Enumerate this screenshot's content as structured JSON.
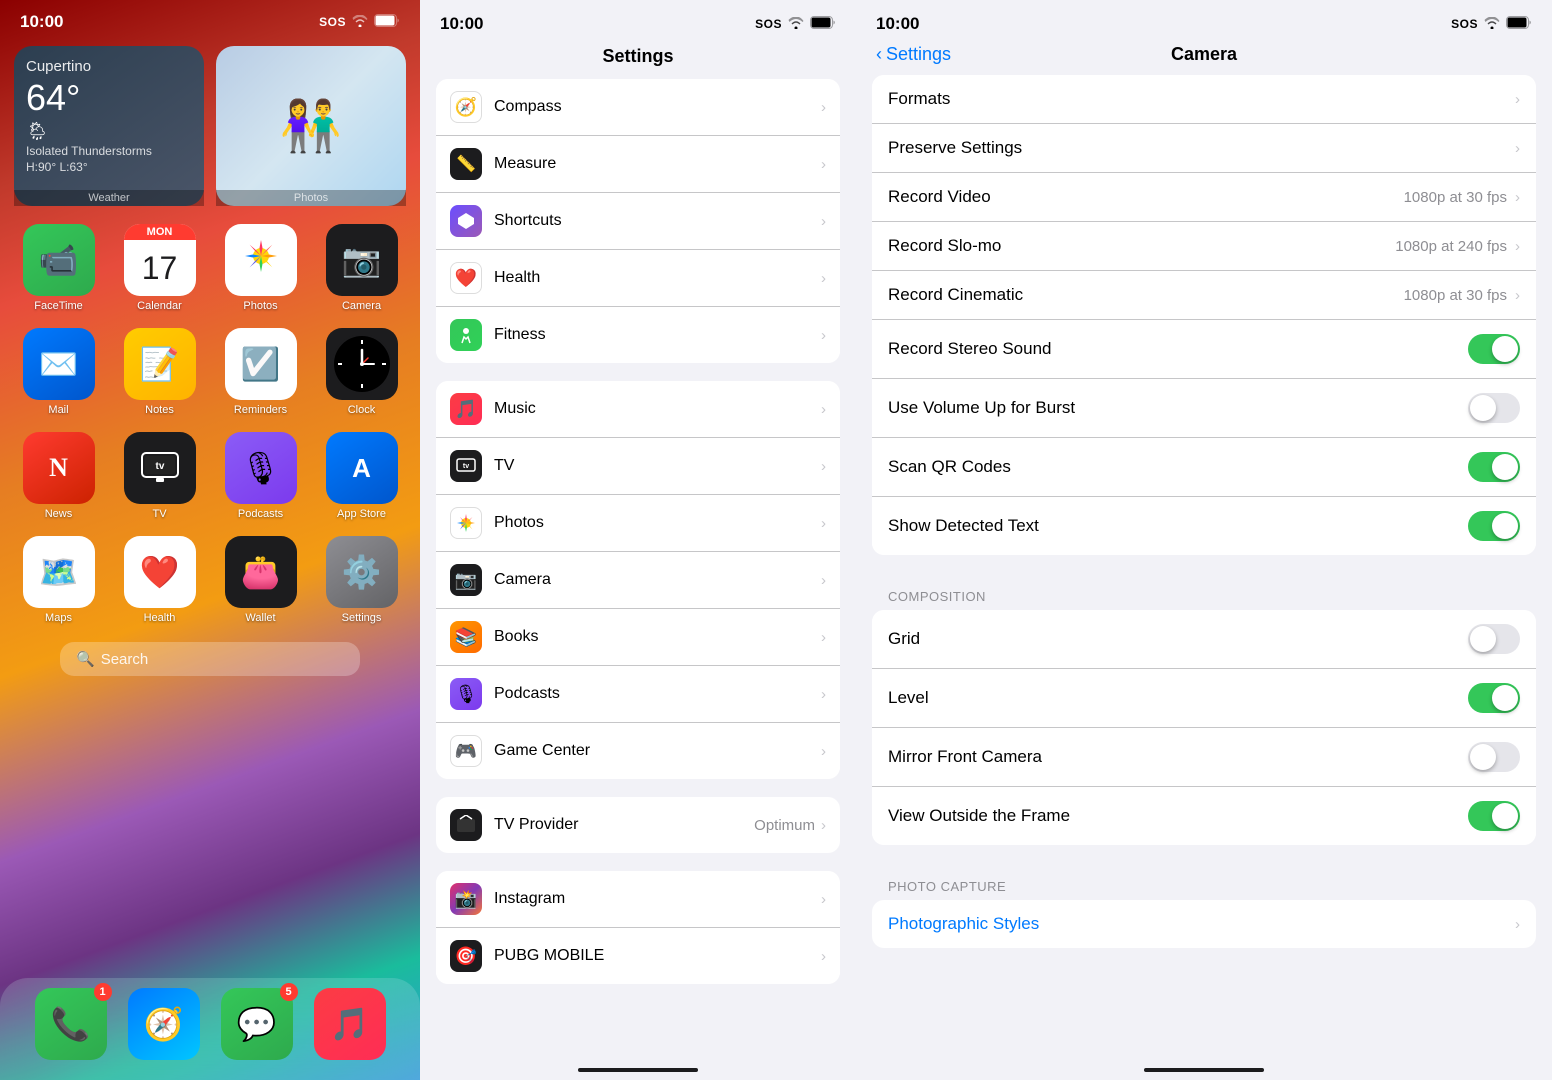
{
  "panel1": {
    "statusBar": {
      "time": "10:00",
      "sos": "SOS",
      "wifi": "wifi",
      "battery": "battery"
    },
    "widgets": {
      "weather": {
        "city": "Cupertino",
        "temp": "64°",
        "icon": "🌦",
        "description": "Isolated Thunderstorms",
        "highLow": "H:90° L:63°",
        "label": "Weather"
      },
      "photos": {
        "label": "Photos"
      }
    },
    "apps": [
      {
        "id": "facetime",
        "label": "FaceTime",
        "icon": "📹",
        "bg": "bg-facetime",
        "badge": ""
      },
      {
        "id": "calendar",
        "label": "Calendar",
        "icon": "calendar",
        "bg": "bg-calendar",
        "badge": ""
      },
      {
        "id": "photos",
        "label": "Photos",
        "icon": "🌸",
        "bg": "bg-photos",
        "badge": ""
      },
      {
        "id": "camera",
        "label": "Camera",
        "icon": "📷",
        "bg": "bg-camera",
        "badge": ""
      },
      {
        "id": "mail",
        "label": "Mail",
        "icon": "✉️",
        "bg": "bg-mail",
        "badge": ""
      },
      {
        "id": "notes",
        "label": "Notes",
        "icon": "📝",
        "bg": "bg-notes",
        "badge": ""
      },
      {
        "id": "reminders",
        "label": "Reminders",
        "icon": "☑️",
        "bg": "bg-reminders",
        "badge": ""
      },
      {
        "id": "clock",
        "label": "Clock",
        "icon": "clock",
        "bg": "bg-clock",
        "badge": ""
      },
      {
        "id": "news",
        "label": "News",
        "icon": "N",
        "bg": "bg-news",
        "badge": ""
      },
      {
        "id": "tv",
        "label": "TV",
        "icon": "tv",
        "bg": "bg-tv",
        "badge": ""
      },
      {
        "id": "podcasts",
        "label": "Podcasts",
        "icon": "🎙",
        "bg": "bg-podcasts",
        "badge": ""
      },
      {
        "id": "appstore",
        "label": "App Store",
        "icon": "A",
        "bg": "bg-appstore",
        "badge": ""
      },
      {
        "id": "maps",
        "label": "Maps",
        "icon": "🗺",
        "bg": "bg-maps",
        "badge": ""
      },
      {
        "id": "health",
        "label": "Health",
        "icon": "❤️",
        "bg": "bg-health",
        "badge": ""
      },
      {
        "id": "wallet",
        "label": "Wallet",
        "icon": "wallet",
        "bg": "bg-wallet",
        "badge": ""
      },
      {
        "id": "settings",
        "label": "Settings",
        "icon": "⚙️",
        "bg": "bg-settings",
        "badge": ""
      }
    ],
    "dock": [
      {
        "id": "phone",
        "label": "Phone",
        "icon": "📞",
        "bg": "bg-facetime",
        "badge": "1"
      },
      {
        "id": "safari",
        "label": "Safari",
        "icon": "🧭",
        "bg": "bg-mail",
        "badge": ""
      },
      {
        "id": "messages",
        "label": "Messages",
        "icon": "💬",
        "bg": "bg-facetime",
        "badge": "5"
      },
      {
        "id": "music",
        "label": "Music",
        "icon": "🎵",
        "bg-music": "bg-music",
        "badge": ""
      }
    ],
    "search": {
      "icon": "🔍",
      "label": "Search"
    },
    "calendar": {
      "month": "MON",
      "day": "17"
    }
  },
  "panel2": {
    "statusBar": {
      "time": "10:00",
      "sos": "SOS"
    },
    "title": "Settings",
    "sections": [
      {
        "items": [
          {
            "id": "compass",
            "label": "Compass",
            "iconBg": "icon-compass",
            "iconEmoji": "🧭"
          },
          {
            "id": "measure",
            "label": "Measure",
            "iconBg": "icon-measure",
            "iconEmoji": "📏"
          },
          {
            "id": "shortcuts",
            "label": "Shortcuts",
            "iconBg": "icon-shortcuts",
            "iconEmoji": "⬡"
          },
          {
            "id": "health",
            "label": "Health",
            "iconBg": "icon-health",
            "iconEmoji": "❤️"
          },
          {
            "id": "fitness",
            "label": "Fitness",
            "iconBg": "icon-fitness",
            "iconEmoji": "🏃"
          }
        ]
      },
      {
        "items": [
          {
            "id": "music",
            "label": "Music",
            "iconBg": "icon-music",
            "iconEmoji": "🎵"
          },
          {
            "id": "tv",
            "label": "TV",
            "iconBg": "icon-tv",
            "iconEmoji": "tv"
          },
          {
            "id": "photos",
            "label": "Photos",
            "iconBg": "icon-photos",
            "iconEmoji": "🌸"
          },
          {
            "id": "camera",
            "label": "Camera",
            "iconBg": "icon-camera",
            "iconEmoji": "📷"
          },
          {
            "id": "books",
            "label": "Books",
            "iconBg": "icon-books",
            "iconEmoji": "📚"
          },
          {
            "id": "podcasts",
            "label": "Podcasts",
            "iconBg": "icon-podcasts",
            "iconEmoji": "🎙"
          },
          {
            "id": "gamecenter",
            "label": "Game Center",
            "iconBg": "icon-gamecenter",
            "iconEmoji": "🎮"
          }
        ]
      },
      {
        "items": [
          {
            "id": "tvprovider",
            "label": "TV Provider",
            "iconBg": "icon-tvprovider",
            "iconEmoji": "📺",
            "value": "Optimum"
          }
        ]
      },
      {
        "items": [
          {
            "id": "instagram",
            "label": "Instagram",
            "iconBg": "icon-instagram",
            "iconEmoji": "📸"
          },
          {
            "id": "pubg",
            "label": "PUBG MOBILE",
            "iconBg": "icon-pubg",
            "iconEmoji": "🎯"
          }
        ]
      }
    ]
  },
  "panel3": {
    "statusBar": {
      "time": "10:00",
      "sos": "SOS"
    },
    "nav": {
      "back": "Settings",
      "title": "Camera"
    },
    "sections": [
      {
        "rows": [
          {
            "id": "formats",
            "label": "Formats",
            "value": "",
            "type": "chevron"
          },
          {
            "id": "preserve",
            "label": "Preserve Settings",
            "value": "",
            "type": "chevron"
          },
          {
            "id": "record-video",
            "label": "Record Video",
            "value": "1080p at 30 fps",
            "type": "chevron"
          },
          {
            "id": "record-slomo",
            "label": "Record Slo-mo",
            "value": "1080p at 240 fps",
            "type": "chevron"
          },
          {
            "id": "record-cinematic",
            "label": "Record Cinematic",
            "value": "1080p at 30 fps",
            "type": "chevron"
          },
          {
            "id": "record-stereo",
            "label": "Record Stereo Sound",
            "value": "",
            "type": "toggle-on"
          },
          {
            "id": "volume-burst",
            "label": "Use Volume Up for Burst",
            "value": "",
            "type": "toggle-off"
          },
          {
            "id": "scan-qr",
            "label": "Scan QR Codes",
            "value": "",
            "type": "toggle-on"
          },
          {
            "id": "show-detected",
            "label": "Show Detected Text",
            "value": "",
            "type": "toggle-on"
          }
        ]
      },
      {
        "header": "COMPOSITION",
        "rows": [
          {
            "id": "grid",
            "label": "Grid",
            "value": "",
            "type": "toggle-off"
          },
          {
            "id": "level",
            "label": "Level",
            "value": "",
            "type": "toggle-on"
          },
          {
            "id": "mirror-front",
            "label": "Mirror Front Camera",
            "value": "",
            "type": "toggle-off"
          },
          {
            "id": "view-outside",
            "label": "View Outside the Frame",
            "value": "",
            "type": "toggle-on"
          }
        ]
      },
      {
        "header": "PHOTO CAPTURE",
        "rows": [
          {
            "id": "photo-styles",
            "label": "Photographic Styles",
            "value": "",
            "type": "link-chevron"
          }
        ]
      }
    ]
  }
}
